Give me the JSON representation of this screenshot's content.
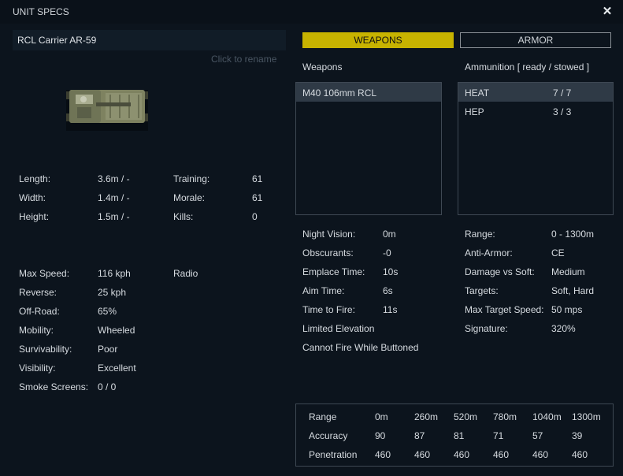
{
  "window": {
    "title": "UNIT SPECS",
    "close_icon": "✕"
  },
  "unit": {
    "name": "RCL Carrier AR-59",
    "rename_hint": "Click to rename"
  },
  "dimensions": [
    {
      "label": "Length:",
      "value": "3.6m / -"
    },
    {
      "label": "Width:",
      "value": "1.4m / -"
    },
    {
      "label": "Height:",
      "value": "1.5m / -"
    }
  ],
  "crew": [
    {
      "label": "Training:",
      "value": "61"
    },
    {
      "label": "Morale:",
      "value": "61"
    },
    {
      "label": "Kills:",
      "value": "0"
    }
  ],
  "mobility_stats": [
    {
      "label": "Max Speed:",
      "value": "116 kph"
    },
    {
      "label": "Reverse:",
      "value": "25 kph"
    },
    {
      "label": "Off-Road:",
      "value": "65%"
    },
    {
      "label": "Mobility:",
      "value": "Wheeled"
    },
    {
      "label": "Survivability:",
      "value": "Poor"
    },
    {
      "label": "Visibility:",
      "value": "Excellent"
    },
    {
      "label": "Smoke Screens:",
      "value": "0 / 0"
    }
  ],
  "equipment": "Radio",
  "tabs": {
    "weapons": "WEAPONS",
    "armor": "ARMOR"
  },
  "weapons": {
    "header": "Weapons",
    "items": [
      "M40 106mm RCL"
    ]
  },
  "ammunition": {
    "header": "Ammunition [ ready / stowed ]",
    "items": [
      {
        "name": "HEAT",
        "count": "7 / 7"
      },
      {
        "name": "HEP",
        "count": "3 / 3"
      }
    ]
  },
  "weapon_stats_left": [
    {
      "label": "Night Vision:",
      "value": "0m"
    },
    {
      "label": "Obscurants:",
      "value": "-0"
    },
    {
      "label": "Emplace Time:",
      "value": "10s"
    },
    {
      "label": "Aim Time:",
      "value": "6s"
    },
    {
      "label": "Time to Fire:",
      "value": "11s"
    }
  ],
  "weapon_notes": [
    "Limited Elevation",
    "Cannot Fire While Buttoned"
  ],
  "weapon_stats_right": [
    {
      "label": "Range:",
      "value": "0 - 1300m"
    },
    {
      "label": "Anti-Armor:",
      "value": "CE"
    },
    {
      "label": "Damage vs Soft:",
      "value": "Medium"
    },
    {
      "label": "Targets:",
      "value": "Soft, Hard"
    },
    {
      "label": "Max Target Speed:",
      "value": "50 mps"
    },
    {
      "label": "Signature:",
      "value": "320%"
    }
  ],
  "range_table": {
    "rows": [
      {
        "label": "Range",
        "cells": [
          "0m",
          "260m",
          "520m",
          "780m",
          "1040m",
          "1300m"
        ]
      },
      {
        "label": "Accuracy",
        "cells": [
          "90",
          "87",
          "81",
          "71",
          "57",
          "39"
        ]
      },
      {
        "label": "Penetration",
        "cells": [
          "460",
          "460",
          "460",
          "460",
          "460",
          "460"
        ]
      }
    ]
  }
}
